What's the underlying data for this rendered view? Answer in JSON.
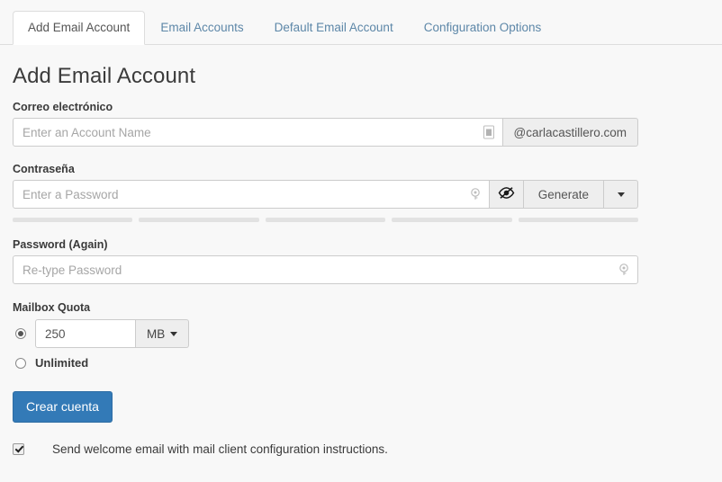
{
  "tabs": [
    {
      "label": "Add Email Account",
      "active": true
    },
    {
      "label": "Email Accounts",
      "active": false
    },
    {
      "label": "Default Email Account",
      "active": false
    },
    {
      "label": "Configuration Options",
      "active": false
    }
  ],
  "page": {
    "title": "Add Email Account"
  },
  "form": {
    "email": {
      "label": "Correo electrónico",
      "placeholder": "Enter an Account Name",
      "value": "",
      "domain_suffix": "@carlacastillero.com",
      "field_icon": "contact-card-icon"
    },
    "password": {
      "label": "Contraseña",
      "placeholder": "Enter a Password",
      "value": "",
      "field_icon": "key-icon",
      "toggle_icon": "eye-slash-icon",
      "generate_label": "Generate",
      "caret_icon": "chevron-down-icon",
      "strength_segments": 5
    },
    "password_again": {
      "label": "Password (Again)",
      "placeholder": "Re-type Password",
      "value": "",
      "field_icon": "key-icon"
    },
    "quota": {
      "label": "Mailbox Quota",
      "value": "250",
      "unit": "MB",
      "unit_caret_icon": "chevron-down-icon",
      "mode": "limited",
      "unlimited_label": "Unlimited"
    },
    "submit_label": "Crear cuenta",
    "welcome_email": {
      "label": "Send welcome email with mail client configuration instructions.",
      "checked": true
    }
  },
  "colors": {
    "primary": "#337ab7",
    "tab_link": "#5d87a8",
    "page_bg": "#f8f8f8",
    "border": "#dddddd"
  }
}
